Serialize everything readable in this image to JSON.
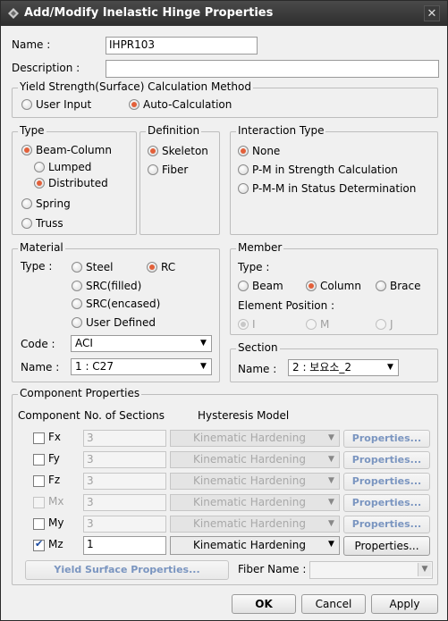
{
  "window": {
    "title": "Add/Modify Inelastic Hinge Properties",
    "close_glyph": "✕"
  },
  "name": {
    "label": "Name :",
    "value": "IHPR103"
  },
  "description": {
    "label": "Description :",
    "value": ""
  },
  "yield": {
    "title": "Yield Strength(Surface) Calculation Method",
    "user_input": "User Input",
    "auto": "Auto-Calculation",
    "selected": "auto"
  },
  "type": {
    "title": "Type",
    "beam_column": "Beam-Column",
    "lumped": "Lumped",
    "distributed": "Distributed",
    "spring": "Spring",
    "truss": "Truss"
  },
  "definition": {
    "title": "Definition",
    "skeleton": "Skeleton",
    "fiber": "Fiber"
  },
  "interaction": {
    "title": "Interaction Type",
    "none": "None",
    "pm": "P-M in Strength Calculation",
    "pmm": "P-M-M in Status Determination"
  },
  "material": {
    "title": "Material",
    "type_label": "Type :",
    "steel": "Steel",
    "rc": "RC",
    "src_filled": "SRC(filled)",
    "src_encased": "SRC(encased)",
    "user_defined": "User Defined",
    "code_label": "Code :",
    "code_value": "ACI",
    "name_label": "Name :",
    "name_value": "1 : C27"
  },
  "member": {
    "title": "Member",
    "type_label": "Type :",
    "beam": "Beam",
    "column": "Column",
    "brace": "Brace",
    "element_position": "Element Position :",
    "pos_i": "I",
    "pos_m": "M",
    "pos_j": "J"
  },
  "section": {
    "title": "Section",
    "name_label": "Name :",
    "name_value": "2 : 보요소_2"
  },
  "component": {
    "title": "Component Properties",
    "col_component": "Component",
    "col_sections": "No. of Sections",
    "col_hysteresis": "Hysteresis Model",
    "rows": [
      {
        "label": "Fx",
        "sections": "3",
        "model": "Kinematic Hardening",
        "button": "Properties...",
        "checked": false,
        "enabled": false
      },
      {
        "label": "Fy",
        "sections": "3",
        "model": "Kinematic Hardening",
        "button": "Properties...",
        "checked": false,
        "enabled": false
      },
      {
        "label": "Fz",
        "sections": "3",
        "model": "Kinematic Hardening",
        "button": "Properties...",
        "checked": false,
        "enabled": false
      },
      {
        "label": "Mx",
        "sections": "3",
        "model": "Kinematic Hardening",
        "button": "Properties...",
        "checked": false,
        "enabled": false
      },
      {
        "label": "My",
        "sections": "3",
        "model": "Kinematic Hardening",
        "button": "Properties...",
        "checked": false,
        "enabled": false
      },
      {
        "label": "Mz",
        "sections": "1",
        "model": "Kinematic Hardening",
        "button": "Properties...",
        "checked": true,
        "enabled": true
      }
    ],
    "yield_surface_button": "Yield Surface Properties...",
    "fiber_name_label": "Fiber Name :",
    "fiber_name_value": ""
  },
  "buttons": {
    "ok": "OK",
    "cancel": "Cancel",
    "apply": "Apply"
  },
  "colors": {
    "radio_selected": "#e2603a",
    "disabled_button_text": "#7a95c0",
    "titlebar": "#2e2e2e"
  }
}
